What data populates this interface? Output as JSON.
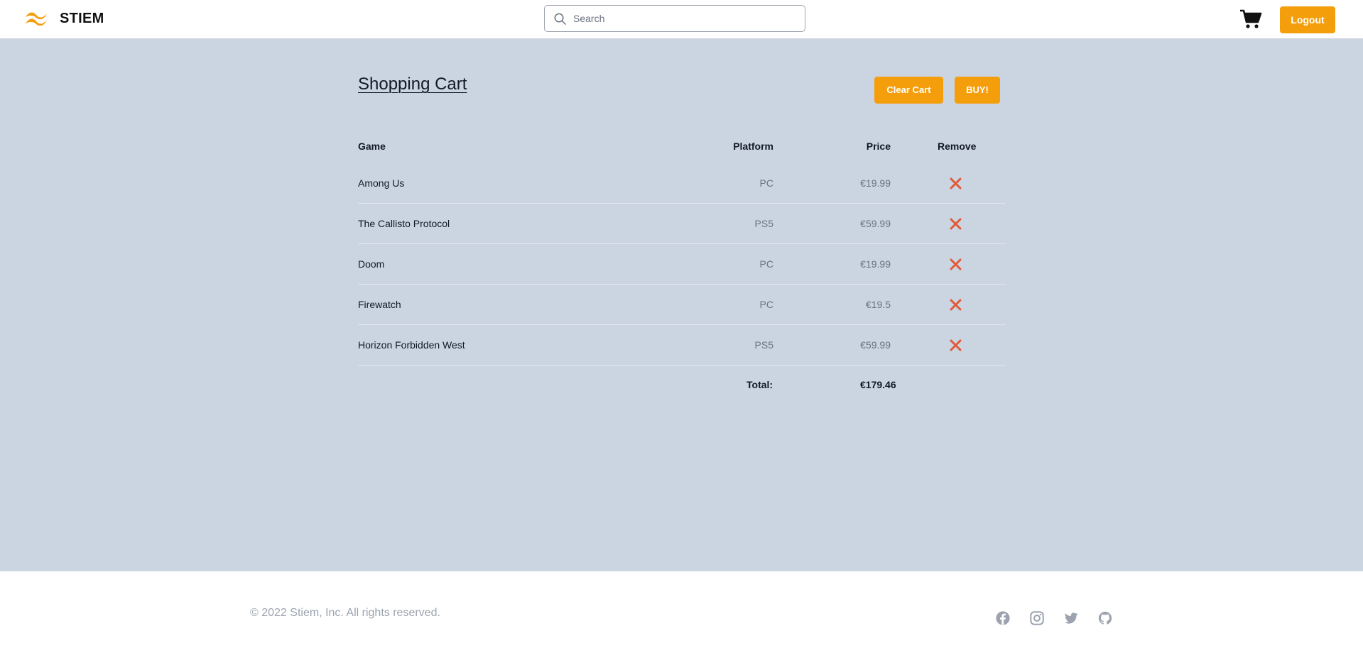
{
  "header": {
    "brand": "STIEM",
    "search_placeholder": "Search",
    "logout_label": "Logout"
  },
  "cart": {
    "title": "Shopping Cart",
    "clear_label": "Clear Cart",
    "buy_label": "BUY!",
    "columns": {
      "game": "Game",
      "platform": "Platform",
      "price": "Price",
      "remove": "Remove"
    },
    "items": [
      {
        "game": "Among Us",
        "platform": "PC",
        "price": "€19.99"
      },
      {
        "game": "The Callisto Protocol",
        "platform": "PS5",
        "price": "€59.99"
      },
      {
        "game": "Doom",
        "platform": "PC",
        "price": "€19.99"
      },
      {
        "game": "Firewatch",
        "platform": "PC",
        "price": "€19.5"
      },
      {
        "game": "Horizon Forbidden West",
        "platform": "PS5",
        "price": "€59.99"
      }
    ],
    "total_label": "Total:",
    "total_value": "€179.46"
  },
  "footer": {
    "copyright": "© 2022 Stiem, Inc. All rights reserved.",
    "social_icons": [
      "facebook-icon",
      "instagram-icon",
      "twitter-icon",
      "github-icon"
    ]
  },
  "colors": {
    "accent": "#f59e0b",
    "page_bg": "#cbd5e1",
    "remove": "#e05a3a"
  }
}
